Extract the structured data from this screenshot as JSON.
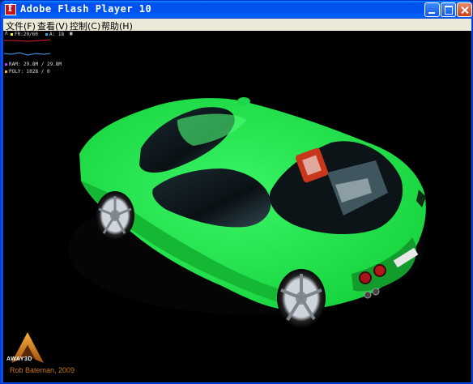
{
  "window": {
    "title": "Adobe Flash Player 10",
    "controls": {
      "minimize": "minimize",
      "maximize": "maximize",
      "close": "close"
    }
  },
  "menu": {
    "items": [
      {
        "label": "文件(F)"
      },
      {
        "label": "查看(V)"
      },
      {
        "label": "控制(C)"
      },
      {
        "label": "帮助(H)"
      }
    ]
  },
  "stats": {
    "fr": "FR:20/60",
    "a": "A: 18",
    "ram": "RAM: 29.8M / 29.8M",
    "poly": "POLY: 1028 / 0"
  },
  "branding": {
    "logo_text": "AWAY3D",
    "credit": "Rob Bateman, 2009"
  },
  "colors": {
    "stage": "#000000",
    "car_body": "#22e84a",
    "credit": "#c8781a"
  }
}
